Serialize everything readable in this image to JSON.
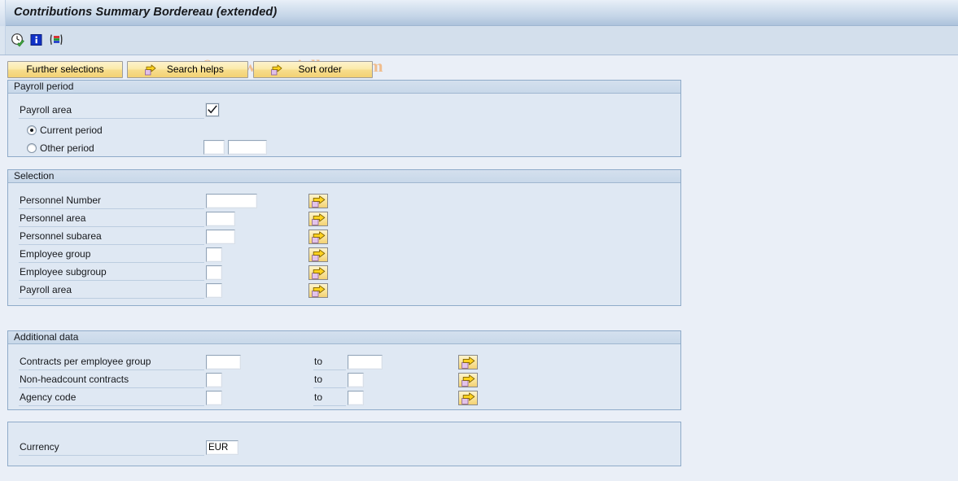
{
  "window": {
    "title": "Contributions Summary Bordereau (extended)"
  },
  "watermark": {
    "text": "© www.tutorialkart.com",
    "color": "#f0bd8d"
  },
  "toolbar": {
    "icons": [
      {
        "name": "execute-clock-icon",
        "label": "Execute"
      },
      {
        "name": "information-icon",
        "label": "Information"
      },
      {
        "name": "variant-icon",
        "label": "Get Variant"
      }
    ]
  },
  "buttons": {
    "further_selections": "Further selections",
    "search_helps": "Search helps",
    "sort_order": "Sort order"
  },
  "payroll_period": {
    "header": "Payroll period",
    "payroll_area_label": "Payroll area",
    "payroll_area_checked": true,
    "current_period_label": "Current period",
    "other_period_label": "Other period",
    "selected_option": "Current period",
    "other_period_value_1": "",
    "other_period_value_2": ""
  },
  "selection": {
    "header": "Selection",
    "rows": [
      {
        "label": "Personnel Number",
        "value": "",
        "multisel": "multiple-selection-icon"
      },
      {
        "label": "Personnel area",
        "value": "",
        "multisel": "multiple-selection-icon"
      },
      {
        "label": "Personnel subarea",
        "value": "",
        "multisel": "multiple-selection-icon"
      },
      {
        "label": "Employee group",
        "value": "",
        "multisel": "multiple-selection-icon"
      },
      {
        "label": "Employee subgroup",
        "value": "",
        "multisel": "multiple-selection-icon"
      },
      {
        "label": "Payroll area",
        "value": "",
        "multisel": "multiple-selection-icon"
      }
    ]
  },
  "additional_data": {
    "header": "Additional data",
    "to_label": "to",
    "rows": [
      {
        "label": "Contracts per employee group",
        "from": "",
        "to": ""
      },
      {
        "label": "Non-headcount contracts",
        "from": "",
        "to": ""
      },
      {
        "label": "Agency code",
        "from": "",
        "to": ""
      }
    ]
  },
  "currency_section": {
    "label": "Currency",
    "value": "EUR"
  },
  "colors": {
    "title_bar_top": "#e9f0f8",
    "title_bar_bottom": "#adc3dc",
    "toolbar_bg": "#d3dfec",
    "page_bg": "#eaeff7",
    "group_bg": "#dfe8f3",
    "group_header_bg": "#c8d8e9",
    "group_border": "#8fabc9",
    "button_yellow": "#f7dd8d",
    "input_bg": "#ffffff"
  }
}
